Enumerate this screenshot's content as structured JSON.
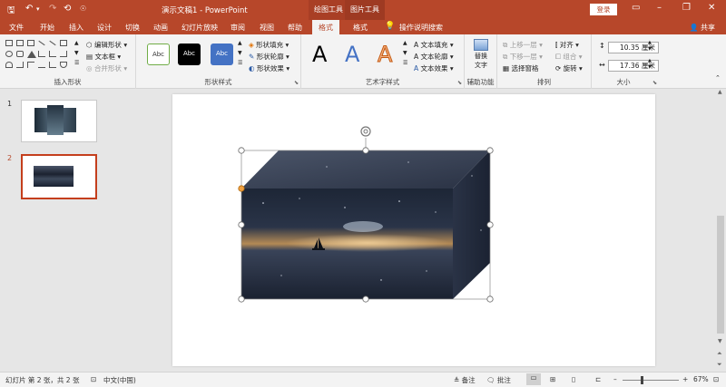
{
  "titlebar": {
    "document_title": "演示文稿1  -  PowerPoint",
    "context_drawing": "绘图工具",
    "context_picture": "图片工具",
    "login": "登录"
  },
  "tabs": [
    "文件",
    "开始",
    "插入",
    "设计",
    "切换",
    "动画",
    "幻灯片放映",
    "审阅",
    "视图",
    "帮助",
    "格式",
    "格式"
  ],
  "active_tab_index": 10,
  "tell_me": "操作说明搜索",
  "share": "共享",
  "ribbon": {
    "insert_shapes": {
      "label": "插入形状",
      "edit_shape": "编辑形状",
      "text_box": "文本框",
      "merge_shapes": "合并形状"
    },
    "shape_styles": {
      "label": "形状样式",
      "samples": [
        "Abc",
        "Abc",
        "Abc"
      ],
      "fill": "形状填充",
      "outline": "形状轮廓",
      "effects": "形状效果"
    },
    "wordart": {
      "label": "艺术字样式",
      "samples": [
        "A",
        "A",
        "A"
      ],
      "text_fill": "文本填充",
      "text_outline": "文本轮廓",
      "text_effects": "文本效果"
    },
    "accessibility": {
      "label": "辅助功能",
      "alt_text_line1": "替换",
      "alt_text_line2": "文字"
    },
    "arrange": {
      "label": "排列",
      "bring_forward": "上移一层",
      "send_backward": "下移一层",
      "selection_pane": "选择窗格",
      "align": "对齐",
      "group": "组合",
      "rotate": "旋转"
    },
    "size": {
      "label": "大小",
      "height": "10.35 厘米",
      "width": "17.36 厘米"
    }
  },
  "slides": {
    "numbers": [
      "1",
      "2"
    ],
    "selected_index": 1
  },
  "status": {
    "slide_info": "幻灯片 第 2 张，共 2 张",
    "language": "中文(中国)",
    "notes": "备注",
    "comments": "批注",
    "zoom": "67%"
  },
  "colors": {
    "accent": "#b7472a",
    "selected_thumb_border": "#c43e1c"
  },
  "icons": {
    "save": "save-icon",
    "undo": "undo-icon",
    "redo": "redo-icon",
    "lightbulb": "lightbulb-icon",
    "rotate_handle": "rotate-handle-icon"
  }
}
